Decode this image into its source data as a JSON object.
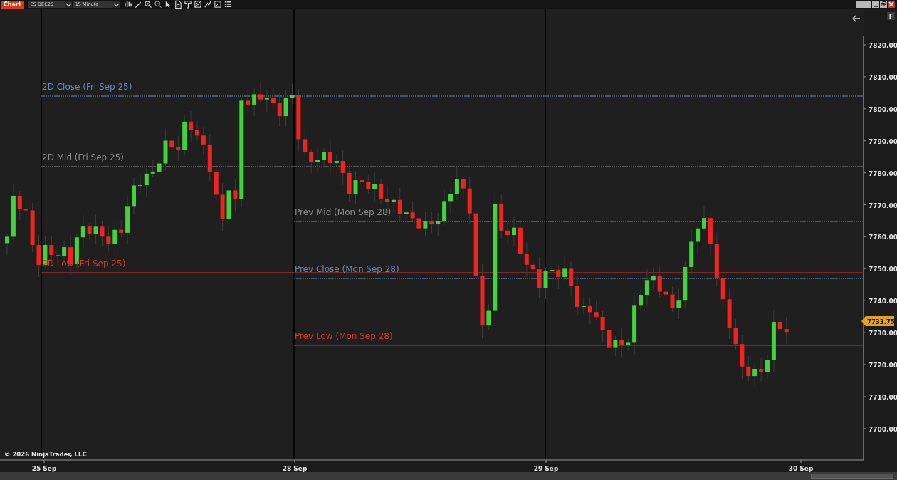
{
  "window": {
    "badge": "Chart",
    "instrument": "ES DEC26",
    "interval": "15 Minute"
  },
  "chart": {
    "y_axis": [
      "7820.00",
      "7810.00",
      "7800.00",
      "7790.00",
      "7780.00",
      "7770.00",
      "7760.00",
      "7750.00",
      "7740.00",
      "7730.00",
      "7720.00",
      "7710.00",
      "7700.00"
    ],
    "x_axis": [
      "25 Sep",
      "28 Sep",
      "29 Sep",
      "30 Sep"
    ],
    "price_marker": "7733.75",
    "copyright": "© 2026 NinjaTrader, LLC",
    "f_button": "F",
    "levels": [
      {
        "label": "2D Close (Fri Sep 25)",
        "color": "#5a8cc4"
      },
      {
        "label": "2D Mid (Fri Sep 25)",
        "color": "#8a8a8a"
      },
      {
        "label": "2D Low (Fri Sep 25)",
        "color": "#e0302a"
      },
      {
        "label": "Prev Mid (Mon Sep 28)",
        "color": "#8a8a8a"
      },
      {
        "label": "Prev Close (Mon Sep 28)",
        "color": "#5a8cc4"
      },
      {
        "label": "Prev Low (Mon Sep 28)",
        "color": "#e0302a"
      }
    ]
  }
}
